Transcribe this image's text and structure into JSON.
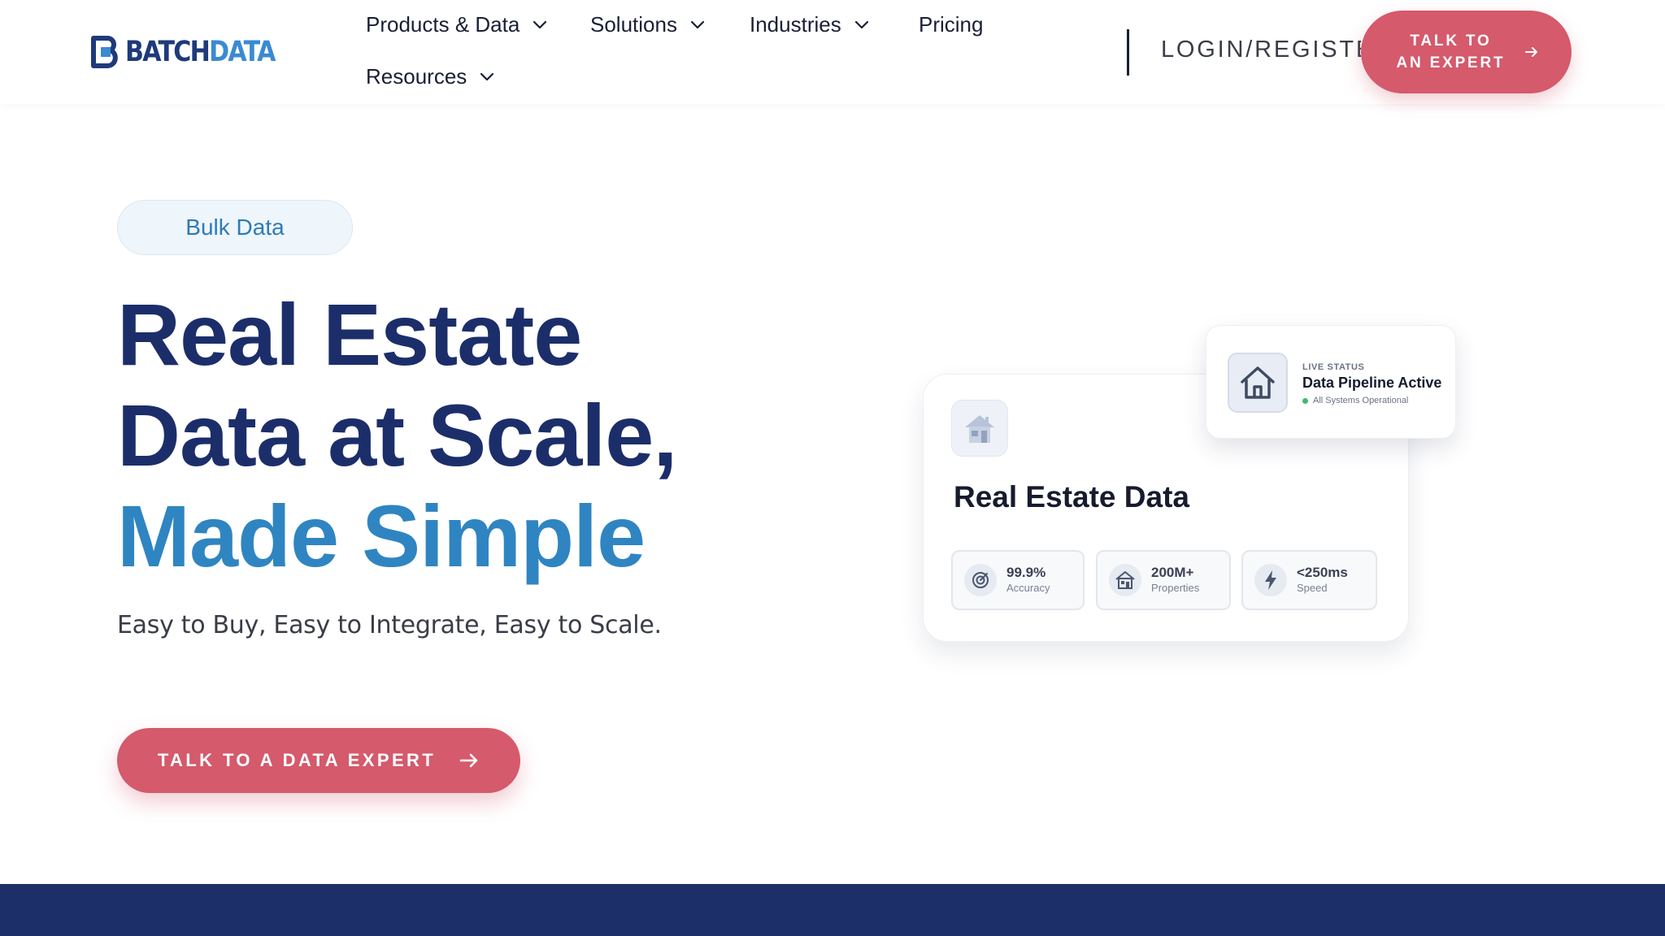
{
  "header": {
    "logo": {
      "prefix": "BATCH",
      "suffix": "DATA"
    },
    "nav": [
      {
        "label": "Products & Data",
        "has_dropdown": true
      },
      {
        "label": "Solutions",
        "has_dropdown": true
      },
      {
        "label": "Industries",
        "has_dropdown": true
      },
      {
        "label": "Pricing",
        "has_dropdown": false
      },
      {
        "label": "Resources",
        "has_dropdown": true
      }
    ],
    "login_label": "LOGIN/REGISTER",
    "cta_label": "TALK TO AN EXPERT"
  },
  "hero": {
    "badge": "Bulk Data",
    "headline_dark": "Real Estate Data at Scale, ",
    "headline_accent": "Made Simple",
    "subtitle": "Easy to Buy, Easy to Integrate, Easy to Scale.",
    "cta_label": "TALK TO A DATA EXPERT"
  },
  "card": {
    "title": "Real Estate Data",
    "stats": [
      {
        "value": "99.9%",
        "label": "Accuracy",
        "icon": "target-icon"
      },
      {
        "value": "200M+",
        "label": "Properties",
        "icon": "house-icon"
      },
      {
        "value": "<250ms",
        "label": "Speed",
        "icon": "lightning-icon"
      }
    ]
  },
  "status_card": {
    "kicker": "LIVE STATUS",
    "title": "Data Pipeline Active",
    "subtitle": "All Systems Operational"
  },
  "colors": {
    "navy": "#1c2e6a",
    "accent_blue": "#2f85c1",
    "cta_red": "#d45a6c",
    "status_green": "#3fba6a",
    "band": "#1d2f68"
  }
}
